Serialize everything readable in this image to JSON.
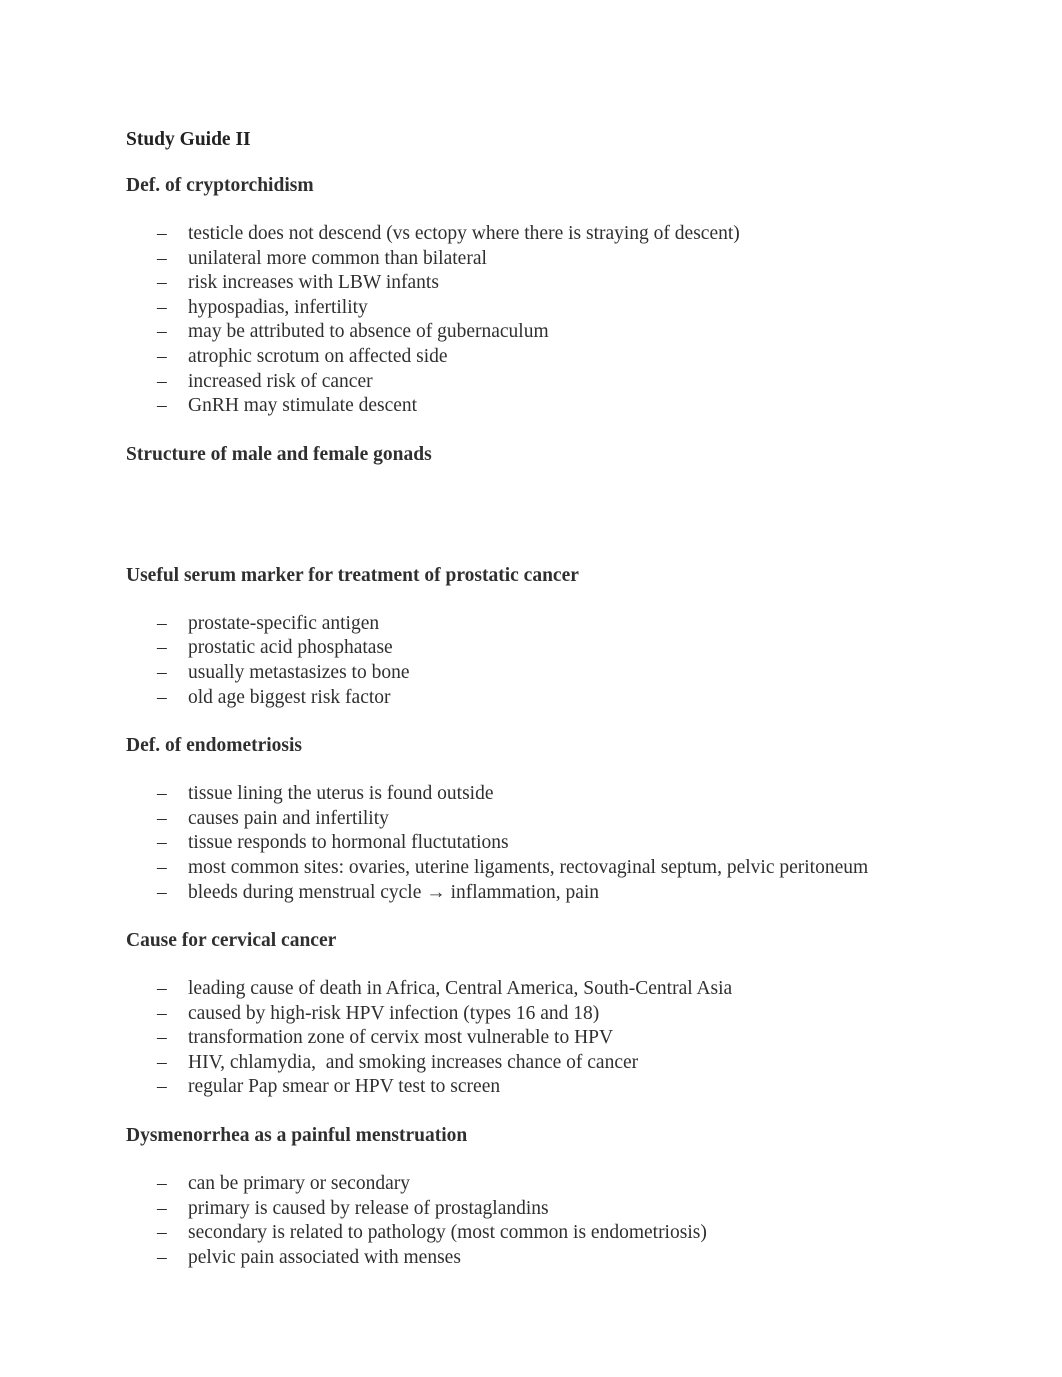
{
  "document": {
    "title": "Study Guide II",
    "bullet_marker": "–",
    "text_color": "#2f2f2f",
    "background_color": "#ffffff",
    "sections": [
      {
        "heading": "Def. of cryptorchidism",
        "items": [
          "testicle does not descend (vs ectopy where there is straying of descent)",
          "unilateral more common than bilateral",
          "risk increases with LBW infants",
          "hypospadias, infertility",
          "may be attributed to absence of gubernaculum",
          "atrophic scrotum on affected side",
          "increased risk of cancer",
          "GnRH may stimulate descent"
        ]
      },
      {
        "heading": "Structure of male and female gonads",
        "items": []
      },
      {
        "heading": "Useful serum marker for treatment of prostatic cancer",
        "items": [
          "prostate-specific antigen",
          "prostatic acid phosphatase",
          "usually metastasizes to bone",
          "old age biggest risk factor"
        ]
      },
      {
        "heading": "Def. of endometriosis",
        "items": [
          "tissue lining the uterus is found outside",
          "causes pain and infertility",
          "tissue responds to hormonal fluctutations",
          "most common sites: ovaries, uterine ligaments, rectovaginal septum, pelvic peritoneum",
          "bleeds during menstrual cycle → inflammation, pain"
        ]
      },
      {
        "heading": "Cause for cervical cancer",
        "items": [
          "leading cause of death in Africa, Central America, South-Central Asia",
          "caused by high-risk HPV infection (types 16 and 18)",
          "transformation zone of cervix most vulnerable to HPV",
          "HIV, chlamydia,  and smoking increases chance of cancer",
          "regular Pap smear or HPV test to screen"
        ]
      },
      {
        "heading": "Dysmenorrhea as a painful menstruation",
        "items": [
          "can be primary or secondary",
          "primary is caused by release of prostaglandins",
          "secondary is related to pathology (most common is endometriosis)",
          "pelvic pain associated with menses"
        ]
      }
    ]
  }
}
